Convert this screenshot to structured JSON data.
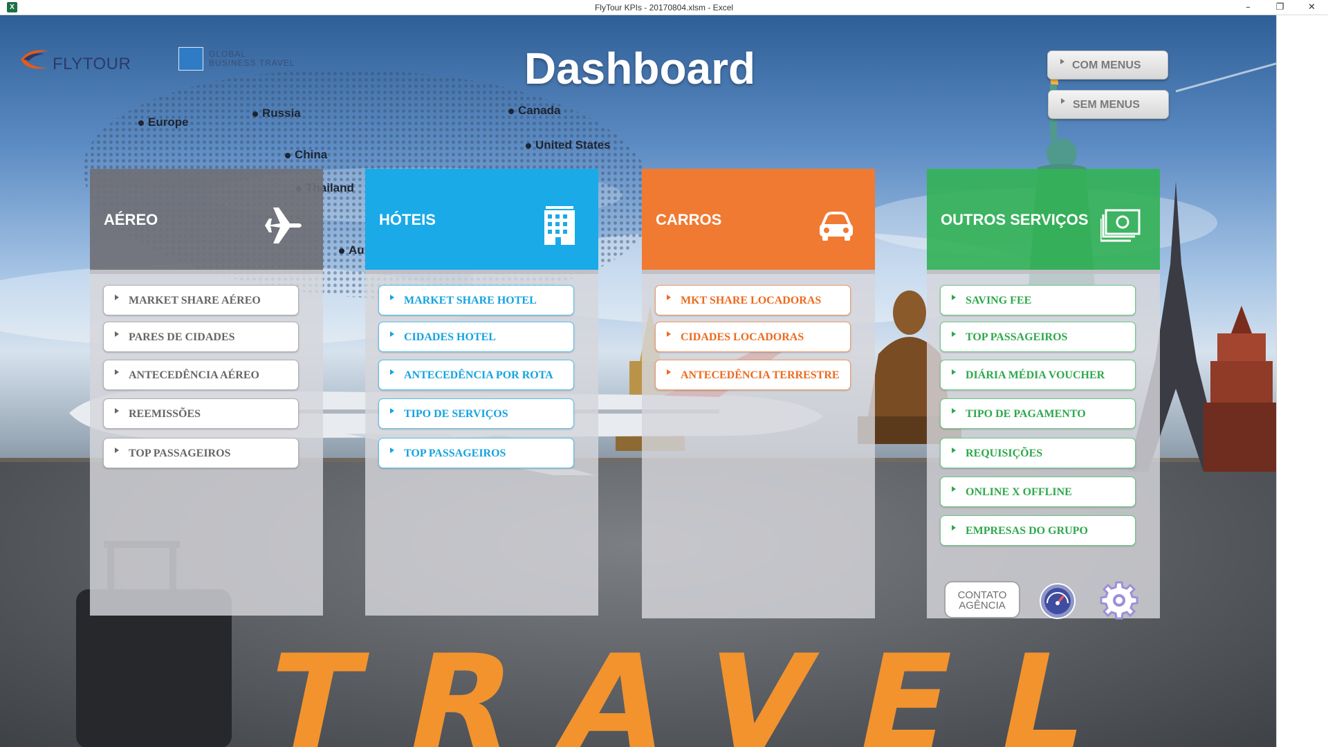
{
  "window": {
    "title": "FlyTour KPIs - 20170804.xlsm - Excel",
    "app_icon": "X",
    "minimize": "–",
    "restore": "❐",
    "close": "✕"
  },
  "header": {
    "brand": "FLYTOUR",
    "partner_line1": "GLOBAL",
    "partner_line2": "BUSINESS TRAVEL",
    "title": "Dashboard",
    "buttons": [
      "COM MENUS",
      "SEM MENUS"
    ]
  },
  "map_labels": [
    "Europe",
    "Russia",
    "China",
    "Thailand",
    "Australia",
    "Canada",
    "United States"
  ],
  "scenery_text": "TRAVEL",
  "panels": {
    "aereo": {
      "title": "AÉREO",
      "icon": "airplane-icon",
      "items": [
        "MARKET SHARE AÉREO",
        "PARES DE CIDADES",
        "ANTECEDÊNCIA AÉREO",
        "REEMISSÕES",
        "TOP PASSAGEIROS"
      ]
    },
    "hoteis": {
      "title": "HÓTEIS",
      "icon": "hotel-building-icon",
      "items": [
        "MARKET SHARE HOTEL",
        "CIDADES HOTEL",
        "ANTECEDÊNCIA POR ROTA",
        "TIPO DE SERVIÇOS",
        "TOP PASSAGEIROS"
      ]
    },
    "carros": {
      "title": "CARROS",
      "icon": "car-icon",
      "items": [
        "MKT SHARE LOCADORAS",
        "CIDADES LOCADORAS",
        "ANTECEDÊNCIA TERRESTRE"
      ]
    },
    "outros": {
      "title": "OUTROS SERVIÇOS",
      "icon": "money-bills-icon",
      "items": [
        "SAVING FEE",
        "TOP PASSAGEIROS",
        "DIÁRIA MÉDIA VOUCHER",
        "TIPO DE PAGAMENTO",
        "REQUISIÇÕES",
        "ONLINE X OFFLINE",
        "EMPRESAS DO GRUPO"
      ],
      "contato_line1": "CONTATO",
      "contato_line2": "AGÊNCIA"
    }
  },
  "colors": {
    "aereo": "#707076",
    "hoteis": "#1aaae8",
    "carros": "#f07a32",
    "outros": "#34b258",
    "title_text": "#ffffff"
  }
}
